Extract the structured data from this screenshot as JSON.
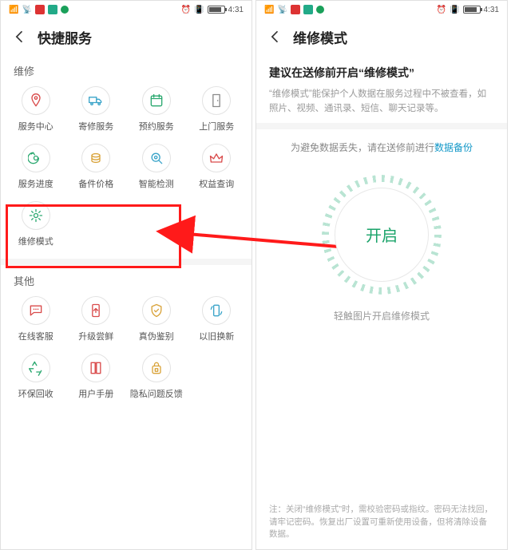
{
  "status": {
    "time": "4:31"
  },
  "left": {
    "title": "快捷服务",
    "sections": {
      "repair": {
        "label": "维修",
        "items": [
          {
            "label": "服务中心",
            "icon": "location-pin-icon",
            "color": "#d94b4b"
          },
          {
            "label": "寄修服务",
            "icon": "truck-icon",
            "color": "#3aa4c9"
          },
          {
            "label": "预约服务",
            "icon": "calendar-icon",
            "color": "#2aa86f"
          },
          {
            "label": "上门服务",
            "icon": "door-icon",
            "color": "#8a8a8a"
          },
          {
            "label": "服务进度",
            "icon": "phone-refresh-icon",
            "color": "#2aa86f"
          },
          {
            "label": "备件价格",
            "icon": "coins-icon",
            "color": "#d9a33a"
          },
          {
            "label": "智能检测",
            "icon": "magnifier-gear-icon",
            "color": "#3aa4c9"
          },
          {
            "label": "权益查询",
            "icon": "crown-icon",
            "color": "#d94b4b"
          },
          {
            "label": "维修模式",
            "icon": "gear-icon",
            "color": "#2aa86f"
          }
        ]
      },
      "other": {
        "label": "其他",
        "items": [
          {
            "label": "在线客服",
            "icon": "chat-icon",
            "color": "#d94b4b"
          },
          {
            "label": "升级尝鲜",
            "icon": "upgrade-icon",
            "color": "#d94b4b"
          },
          {
            "label": "真伪鉴别",
            "icon": "shield-icon",
            "color": "#d9a33a"
          },
          {
            "label": "以旧换新",
            "icon": "recycle-phone-icon",
            "color": "#3aa4c9"
          },
          {
            "label": "环保回收",
            "icon": "recycle-icon",
            "color": "#2aa86f"
          },
          {
            "label": "用户手册",
            "icon": "book-icon",
            "color": "#d94b4b"
          },
          {
            "label": "隐私问题反馈",
            "icon": "lock-bag-icon",
            "color": "#d9a33a"
          }
        ]
      }
    }
  },
  "right": {
    "title": "维修模式",
    "headline": "建议在送修前开启“维修模式”",
    "desc": "“维修模式”能保护个人数据在服务过程中不被查看，如照片、视频、通讯录、短信、聊天记录等。",
    "backup_prefix": "为避免数据丢失，请在送修前进行",
    "backup_link": "数据备份",
    "button": "开启",
    "hint": "轻触图片开启维修模式",
    "note": "注：关闭“维修模式”时，需校验密码或指纹。密码无法找回，请牢记密码。恢复出厂设置可重新使用设备，但将清除设备数据。"
  },
  "annotation": {
    "highlight_target": "维修模式"
  }
}
